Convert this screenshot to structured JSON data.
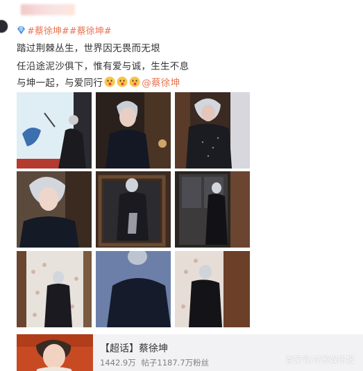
{
  "post": {
    "topics": [
      "#蔡徐坤#",
      "#蔡徐坤#"
    ],
    "line1": "踏过荆棘丛生，世界因无畏而无垠",
    "line2": "任沿途泥沙俱下，惟有爱与诚，生生不息",
    "line3": "与坤一起，与爱同行",
    "mention": "@蔡徐坤"
  },
  "photos_count": 9,
  "card": {
    "title": "【超话】蔡徐坤",
    "reads": "1442.9万",
    "posts": "帖子1187.7万粉丝"
  },
  "watermark": "百家号/洋葱娱乐报",
  "colors": {
    "accent": "#eb7350",
    "text": "#333333",
    "muted": "#808080",
    "card_bg": "#f2f2f5"
  },
  "icons": [
    "topic-diamond-icon",
    "kiss-face-emoji-icon"
  ]
}
